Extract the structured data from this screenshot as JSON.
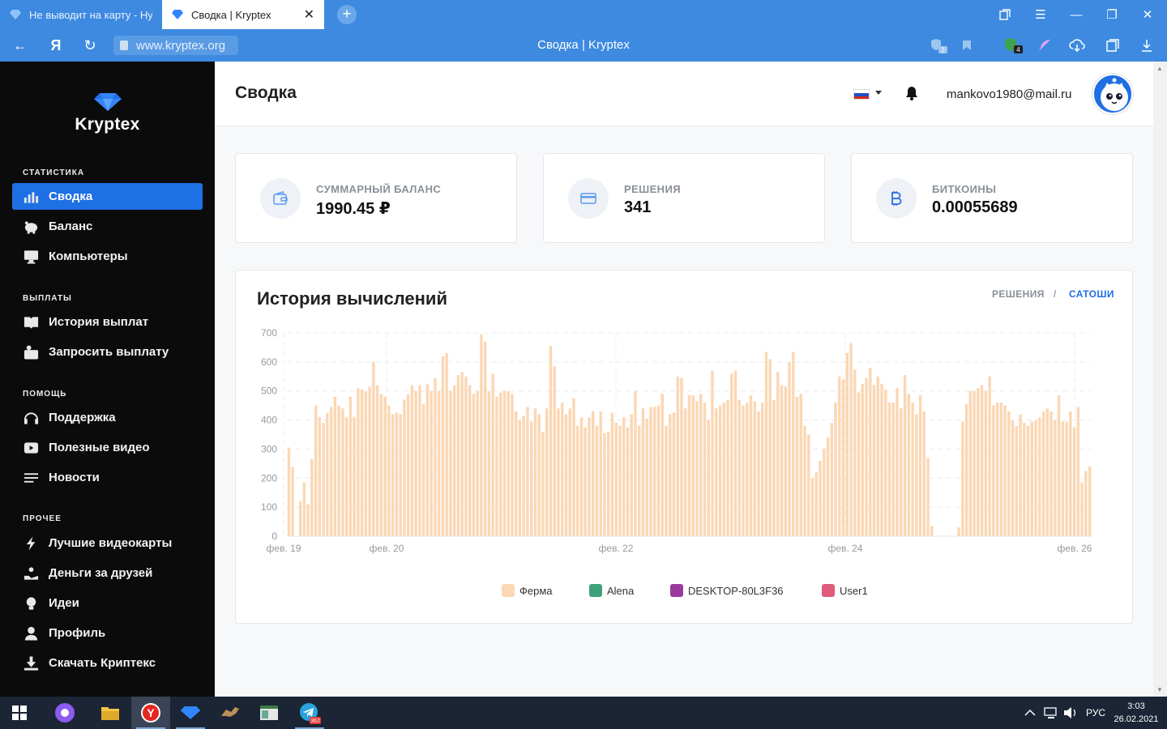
{
  "browser": {
    "tabs": [
      {
        "title": "Не выводит на карту - Ну"
      },
      {
        "title": "Сводка | Kryptex"
      }
    ],
    "new_tab": "+",
    "url": "www.kryptex.org",
    "page_title": "Сводка | Kryptex",
    "badge_protect": "2",
    "badge_ext": "4"
  },
  "sidebar": {
    "brand": "Kryptex",
    "sections": [
      {
        "title": "СТАТИСТИКА",
        "items": [
          {
            "label": "Сводка",
            "icon": "bar-chart-icon",
            "active": true
          },
          {
            "label": "Баланс",
            "icon": "piggy-bank-icon"
          },
          {
            "label": "Компьютеры",
            "icon": "monitor-icon"
          }
        ]
      },
      {
        "title": "ВЫПЛАТЫ",
        "items": [
          {
            "label": "История выплат",
            "icon": "book-icon"
          },
          {
            "label": "Запросить выплату",
            "icon": "wallet-request-icon"
          }
        ]
      },
      {
        "title": "ПОМОЩЬ",
        "items": [
          {
            "label": "Поддержка",
            "icon": "headset-icon"
          },
          {
            "label": "Полезные видео",
            "icon": "video-icon"
          },
          {
            "label": "Новости",
            "icon": "news-lines-icon"
          }
        ]
      },
      {
        "title": "ПРОЧЕЕ",
        "items": [
          {
            "label": "Лучшие видеокарты",
            "icon": "bolt-icon"
          },
          {
            "label": "Деньги за друзей",
            "icon": "referral-icon"
          },
          {
            "label": "Идеи",
            "icon": "lightbulb-icon"
          },
          {
            "label": "Профиль",
            "icon": "user-icon"
          },
          {
            "label": "Скачать Криптекс",
            "icon": "download-icon"
          }
        ]
      }
    ]
  },
  "header": {
    "title": "Сводка",
    "email": "mankovo1980@mail.ru",
    "language": "ru"
  },
  "cards": [
    {
      "label": "СУММАРНЫЙ БАЛАНС",
      "value": "1990.45 ₽",
      "icon": "wallet-icon"
    },
    {
      "label": "РЕШЕНИЯ",
      "value": "341",
      "icon": "card-icon"
    },
    {
      "label": "БИТКОИНЫ",
      "value": "0.00055689",
      "icon": "bitcoin-icon"
    }
  ],
  "history": {
    "title": "История вычислений",
    "toggle": [
      "РЕШЕНИЯ",
      "/",
      "САТОШИ"
    ],
    "active_toggle": "САТОШИ"
  },
  "colors": {
    "accent": "#1f6fe5",
    "sidebar_bg": "#0b0b0b",
    "browser_bar": "#3d8ae0",
    "bar_ferma": "#fbd7b4"
  },
  "chart_data": {
    "type": "bar",
    "title": "",
    "xlabel": "",
    "ylabel": "",
    "ylim": [
      0,
      700
    ],
    "yticks": [
      0,
      100,
      200,
      300,
      400,
      500,
      600,
      700
    ],
    "xticks": [
      "фев. 19",
      "фев. 20",
      "фев. 22",
      "фев. 24",
      "фев. 26"
    ],
    "grid": true,
    "legend_position": "bottom",
    "series": [
      {
        "name": "Ферма",
        "color": "#fbd7b4",
        "values": [
          305,
          238,
          0,
          120,
          185,
          110,
          265,
          450,
          410,
          390,
          425,
          445,
          480,
          450,
          440,
          410,
          480,
          410,
          510,
          505,
          500,
          515,
          600,
          520,
          490,
          480,
          450,
          420,
          425,
          420,
          470,
          490,
          520,
          500,
          520,
          455,
          525,
          500,
          545,
          500,
          620,
          630,
          500,
          520,
          555,
          565,
          550,
          520,
          490,
          500,
          695,
          670,
          500,
          560,
          480,
          495,
          500,
          500,
          490,
          430,
          400,
          415,
          445,
          395,
          440,
          420,
          360,
          440,
          655,
          585,
          440,
          460,
          420,
          440,
          475,
          380,
          410,
          375,
          410,
          430,
          380,
          430,
          355,
          360,
          425,
          390,
          380,
          410,
          375,
          420,
          500,
          380,
          440,
          405,
          445,
          445,
          450,
          490,
          380,
          420,
          425,
          550,
          545,
          440,
          485,
          485,
          465,
          490,
          460,
          400,
          570,
          440,
          450,
          460,
          470,
          560,
          570,
          470,
          450,
          460,
          485,
          465,
          430,
          460,
          635,
          610,
          470,
          565,
          520,
          515,
          600,
          635,
          480,
          490,
          380,
          350,
          200,
          220,
          260,
          300,
          340,
          390,
          460,
          550,
          540,
          630,
          665,
          575,
          495,
          525,
          545,
          580,
          520,
          550,
          525,
          505,
          460,
          460,
          510,
          440,
          555,
          490,
          460,
          420,
          485,
          430,
          270,
          35,
          0,
          0,
          0,
          0,
          0,
          0,
          30,
          395,
          455,
          500,
          500,
          510,
          520,
          500,
          550,
          450,
          460,
          460,
          450,
          430,
          400,
          380,
          420,
          390,
          380,
          395,
          400,
          410,
          430,
          440,
          430,
          400,
          485,
          395,
          395,
          430,
          375,
          445,
          185,
          225,
          240
        ]
      },
      {
        "name": "Alena",
        "color": "#3ea17a",
        "values": []
      },
      {
        "name": "DESKTOP-80L3F36",
        "color": "#9b3a9e",
        "values": []
      },
      {
        "name": "User1",
        "color": "#e05c7a",
        "values": []
      }
    ]
  },
  "taskbar": {
    "tray_lang": "РУС",
    "time": "3:03",
    "date": "26.02.2021",
    "telegram_badge": "362"
  }
}
